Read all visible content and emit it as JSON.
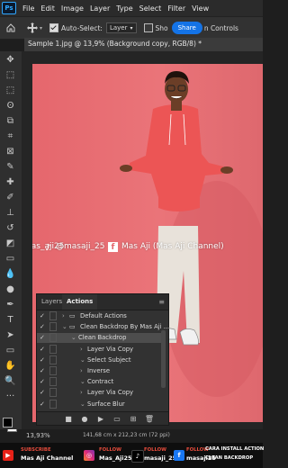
{
  "menu": {
    "logo": "Ps",
    "items": [
      "File",
      "Edit",
      "Image",
      "Layer",
      "Type",
      "Select",
      "Filter",
      "View"
    ]
  },
  "options": {
    "auto_select_label": "Auto-Select:",
    "layer_dropdown": "Layer",
    "show_transform": "Sho",
    "share_label": "Share",
    "controls_label": "n Controls"
  },
  "document": {
    "tab_title": "Sample 1.jpg @ 13,9% (Background copy, RGB/8) *"
  },
  "overlay": {
    "instagram": "mas_aji25",
    "tiktok": "@masaji_25",
    "facebook": "Mas Aji (Mas Aji Channel)"
  },
  "actions_panel": {
    "tabs": [
      "Layers",
      "Actions"
    ],
    "rows": [
      {
        "label": "Default Actions",
        "indent": 0,
        "type": "folder",
        "expanded": false
      },
      {
        "label": "Clean Backdrop By Mas Aji ...",
        "indent": 0,
        "type": "folder",
        "expanded": true
      },
      {
        "label": "Clean Backdrop",
        "indent": 1,
        "type": "action",
        "expanded": true,
        "selected": true
      },
      {
        "label": "Layer Via Copy",
        "indent": 2,
        "type": "step",
        "expanded": false
      },
      {
        "label": "Select Subject",
        "indent": 2,
        "type": "step",
        "expanded": true
      },
      {
        "label": "Inverse",
        "indent": 2,
        "type": "step",
        "expanded": false
      },
      {
        "label": "Contract",
        "indent": 2,
        "type": "step",
        "expanded": true
      },
      {
        "label": "Layer Via Copy",
        "indent": 2,
        "type": "step",
        "expanded": false
      },
      {
        "label": "Surface Blur",
        "indent": 2,
        "type": "step",
        "expanded": true
      }
    ]
  },
  "status": {
    "zoom": "13,93%",
    "info": "141,68 cm x 212,23 cm (72 ppi)"
  },
  "banner": {
    "items": [
      {
        "small": "SUBSCRIBE",
        "big": "Mas Aji Channel"
      },
      {
        "small": "FOLLOW",
        "big": "Mas_Aji25"
      },
      {
        "small": "FOLLOW",
        "big": "masaji_25"
      },
      {
        "small": "FOLLOW",
        "big": "masaji25"
      }
    ],
    "promo_line1": "CARA INSTALL ACTION",
    "promo_line2": "CLEAN BACKDROP"
  },
  "colors": {
    "backdrop": "#e8696f",
    "accent": "#1473e6",
    "subscribe_red": "#e74c3c"
  }
}
